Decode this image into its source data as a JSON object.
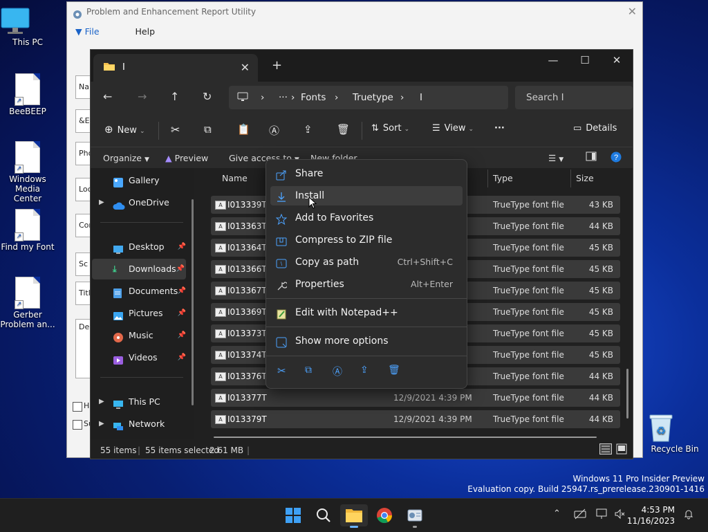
{
  "desktop": {
    "icons": [
      {
        "label": "This PC"
      },
      {
        "label": "BeeBEEP"
      },
      {
        "label": "Windows Media Center"
      },
      {
        "label": "Find my Font"
      },
      {
        "label": "Gerber Problem an..."
      },
      {
        "label": "Recycle Bin"
      }
    ],
    "watermark": {
      "line1": "Windows 11 Pro Insider Preview",
      "line2": "Evaluation copy. Build 25947.rs_prerelease.230901-1416"
    }
  },
  "utility_window": {
    "title": "Problem and Enhancement Report Utility",
    "menu": {
      "file": "File",
      "help": "Help"
    },
    "field_stubs": [
      "Na",
      "&E",
      "Pho",
      "Loc",
      "Cor",
      "Sc",
      "Title",
      "De"
    ],
    "check_stubs": [
      "Ha",
      "Su"
    ]
  },
  "explorer": {
    "tab": {
      "label": "I",
      "close": "✕",
      "new": "+"
    },
    "window_controls": {
      "minimize": "—",
      "maximize": "☐",
      "close": "✕"
    },
    "address": {
      "ellipsis": "···",
      "segments": [
        "Fonts",
        "Truetype",
        "I"
      ]
    },
    "search": {
      "placeholder": "Search I"
    },
    "commands": {
      "new": "New",
      "sort": "Sort",
      "view": "View",
      "more": "···",
      "details": "Details"
    },
    "ribbon": {
      "organize": "Organize",
      "preview": "Preview",
      "give_access": "Give access to",
      "new_folder": "New folder"
    },
    "nav": {
      "gallery": "Gallery",
      "onedrive": "OneDrive",
      "desktop": "Desktop",
      "downloads": "Downloads",
      "documents": "Documents",
      "pictures": "Pictures",
      "music": "Music",
      "videos": "Videos",
      "this_pc": "This PC",
      "network": "Network"
    },
    "columns": {
      "name": "Name",
      "type": "Type",
      "size": "Size"
    },
    "files": [
      {
        "name": "I013339T",
        "date": "",
        "type": "TrueType font file",
        "size": "43 KB"
      },
      {
        "name": "I013363T",
        "date": "",
        "type": "TrueType font file",
        "size": "44 KB"
      },
      {
        "name": "I013364T",
        "date": "",
        "type": "TrueType font file",
        "size": "45 KB"
      },
      {
        "name": "I013366T",
        "date": "",
        "type": "TrueType font file",
        "size": "45 KB"
      },
      {
        "name": "I013367T",
        "date": "",
        "type": "TrueType font file",
        "size": "45 KB"
      },
      {
        "name": "I013369T",
        "date": "",
        "type": "TrueType font file",
        "size": "45 KB"
      },
      {
        "name": "I013373T",
        "date": "",
        "type": "TrueType font file",
        "size": "45 KB"
      },
      {
        "name": "I013374T",
        "date": "",
        "type": "TrueType font file",
        "size": "45 KB"
      },
      {
        "name": "I013376T",
        "date": "",
        "type": "TrueType font file",
        "size": "44 KB"
      },
      {
        "name": "I013377T",
        "date": "12/9/2021 4:39 PM",
        "type": "TrueType font file",
        "size": "44 KB"
      },
      {
        "name": "I013379T",
        "date": "12/9/2021 4:39 PM",
        "type": "TrueType font file",
        "size": "44 KB"
      }
    ],
    "status": {
      "items": "55 items",
      "selected": "55 items selected",
      "size": "2.61 MB"
    }
  },
  "context_menu": {
    "share": "Share",
    "install": "Install",
    "favorites": "Add to Favorites",
    "compress": "Compress to ZIP file",
    "copy_path": "Copy as path",
    "copy_path_shortcut": "Ctrl+Shift+C",
    "properties": "Properties",
    "properties_shortcut": "Alt+Enter",
    "notepad": "Edit with Notepad++",
    "more_options": "Show more options"
  },
  "taskbar": {
    "time": "4:53 PM",
    "date": "11/16/2023"
  },
  "colors": {
    "accent": "#4da3ff",
    "wallpaper": "#0b2f9c",
    "menu_bg": "#2c2c2c"
  }
}
